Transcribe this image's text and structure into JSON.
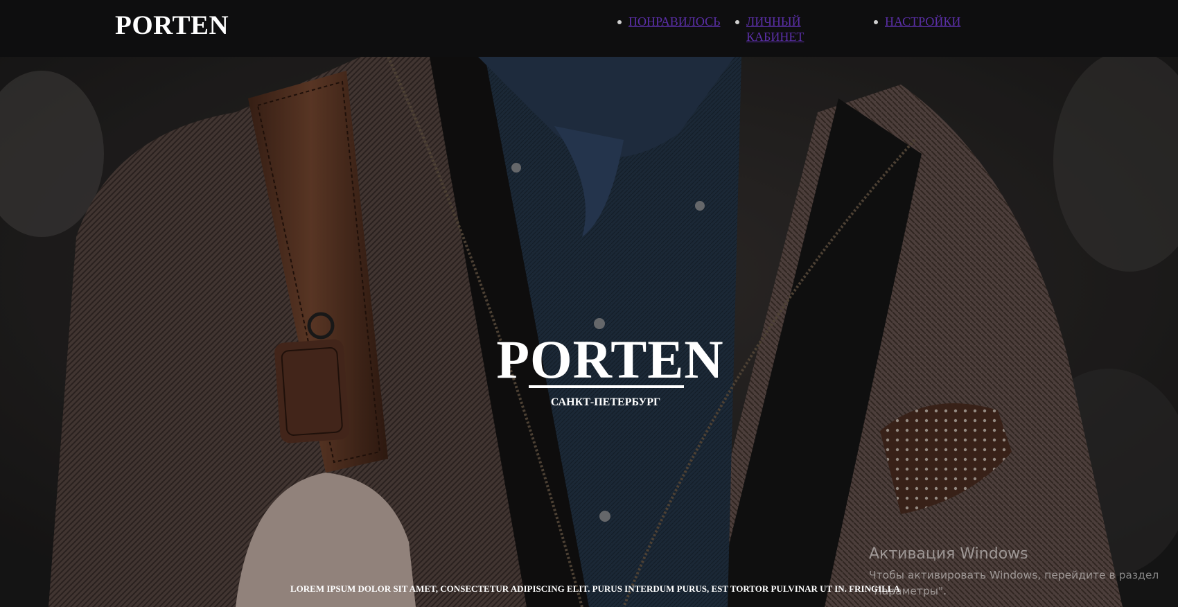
{
  "header": {
    "logo": "PORTEN",
    "nav": [
      {
        "label": "Понравилось"
      },
      {
        "label": "Личный кабинет"
      },
      {
        "label": "Настройки"
      }
    ]
  },
  "hero": {
    "title": "PORTEN",
    "subtitle": "САНКТ-ПЕТЕРБУРГ",
    "footer_text": "Lorem ipsum dolor sit amet, consectetur adipiscing elit. Purus interdum purus, est tortor pulvinar ut in. Fringilla"
  },
  "watermark": {
    "title": "Активация Windows",
    "subtitle": "Чтобы активировать Windows, перейдите в раздел \"Параметры\"."
  },
  "colors": {
    "header_bg": "#0e0e0f",
    "link": "#5b2fa8",
    "text": "#ffffff"
  }
}
